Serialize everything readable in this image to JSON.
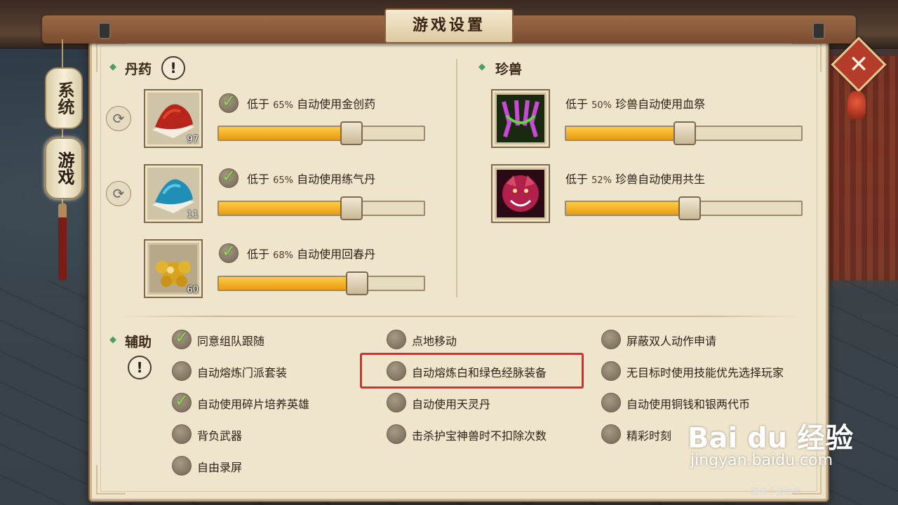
{
  "title": "游戏设置",
  "side_tabs": [
    {
      "label": "系统"
    },
    {
      "label": "游戏"
    }
  ],
  "potions": {
    "header": "丹药",
    "items": [
      {
        "qty": "97",
        "prefix": "低于",
        "pct": "65%",
        "text": "自动使用金创药",
        "checked": true,
        "value": 0.65
      },
      {
        "qty": "11",
        "prefix": "低于",
        "pct": "65%",
        "text": "自动使用练气丹",
        "checked": true,
        "value": 0.65
      },
      {
        "qty": "60",
        "prefix": "低于",
        "pct": "68%",
        "text": "自动使用回春丹",
        "checked": true,
        "value": 0.68
      }
    ]
  },
  "beasts": {
    "header": "珍兽",
    "items": [
      {
        "prefix": "低于",
        "pct": "50%",
        "text": "珍兽自动使用血祭",
        "value": 0.5
      },
      {
        "prefix": "低于",
        "pct": "52%",
        "text": "珍兽自动使用共生",
        "value": 0.52
      }
    ]
  },
  "assist": {
    "header": "辅助",
    "options": [
      {
        "label": "同意组队跟随",
        "checked": true
      },
      {
        "label": "点地移动",
        "checked": false
      },
      {
        "label": "屏蔽双人动作申请",
        "checked": false
      },
      {
        "label": "自动熔炼门派套装",
        "checked": false
      },
      {
        "label": "自动熔炼白和绿色经脉装备",
        "checked": false
      },
      {
        "label": "无目标时使用技能优先选择玩家",
        "checked": false
      },
      {
        "label": "自动使用碎片培养英雄",
        "checked": true
      },
      {
        "label": "自动使用天灵丹",
        "checked": false
      },
      {
        "label": "自动使用铜钱和银两代币",
        "checked": false
      },
      {
        "label": "背负武器",
        "checked": false
      },
      {
        "label": "击杀护宝神兽时不扣除次数",
        "checked": false
      },
      {
        "label": "精彩时刻",
        "checked": false
      },
      {
        "label": "自由录屏",
        "checked": false
      }
    ]
  },
  "watermark": {
    "logo": "Bai du 经验",
    "url": "jingyan.baidu.com",
    "small": "腾讯手游助手"
  },
  "colors": {
    "panel": "#efe4cc",
    "slider_fill": "#f0a51a",
    "highlight": "#e8262a",
    "check": "#9bd65c"
  }
}
